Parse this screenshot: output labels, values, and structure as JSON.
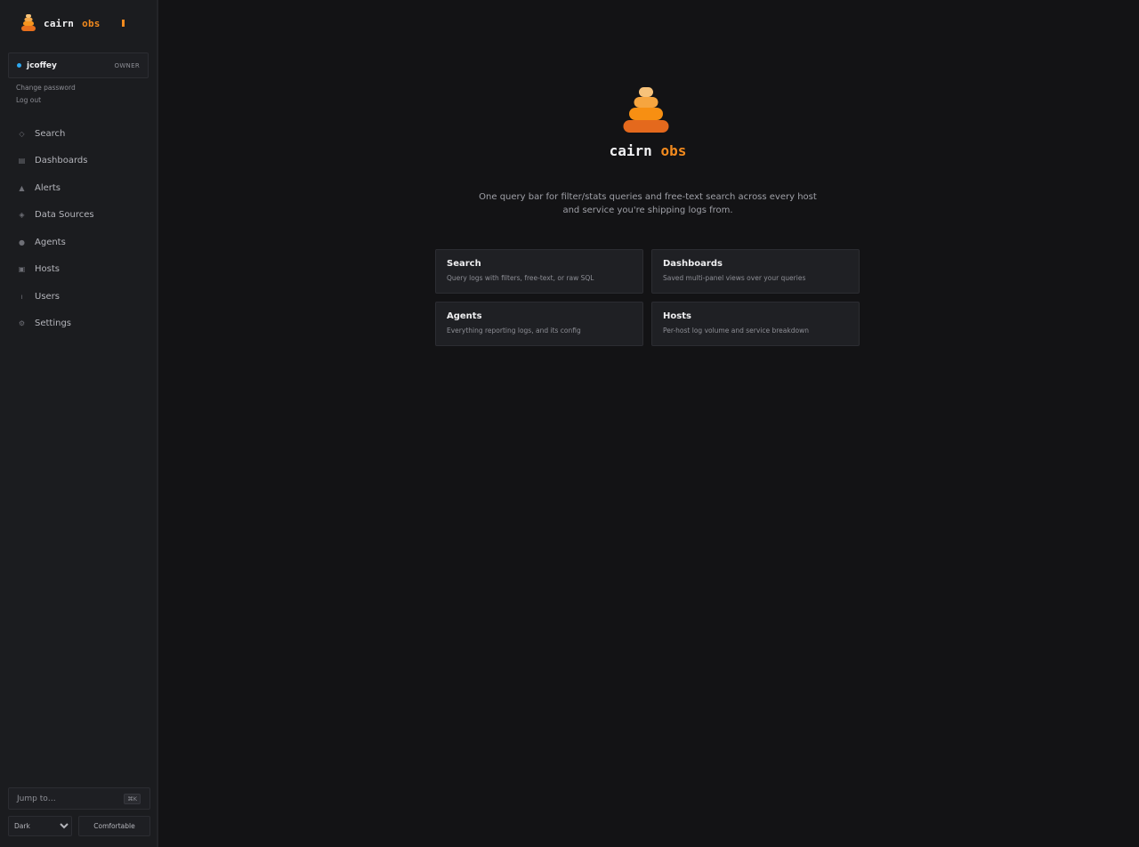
{
  "brand": {
    "name": "cairn",
    "accent": "obs",
    "accent_color": "#f28a1e"
  },
  "user": {
    "name": "jcoffey",
    "role": "OWNER",
    "status_color": "#2ea8ef"
  },
  "user_links": {
    "change_password": "Change password",
    "logout": "Log out"
  },
  "nav": {
    "items": [
      {
        "label": "Search",
        "icon": "diamond-outline-icon"
      },
      {
        "label": "Dashboards",
        "icon": "dashboard-grid-icon"
      },
      {
        "label": "Alerts",
        "icon": "triangle-alert-icon"
      },
      {
        "label": "Data Sources",
        "icon": "diamond-dot-icon"
      },
      {
        "label": "Agents",
        "icon": "dot-icon"
      },
      {
        "label": "Hosts",
        "icon": "server-square-icon"
      },
      {
        "label": "Users",
        "icon": "user-icon"
      },
      {
        "label": "Settings",
        "icon": "gear-icon"
      }
    ]
  },
  "jump": {
    "label": "Jump to…",
    "shortcut": "⌘K"
  },
  "footer": {
    "theme": "Dark",
    "density": "Comfortable"
  },
  "hero": {
    "title_main": "cairn",
    "title_accent": "obs",
    "description": "One query bar for filter/stats queries and free-text search across every host and service you're shipping logs from."
  },
  "cards": [
    {
      "title": "Search",
      "desc": "Query logs with filters, free-text, or raw SQL"
    },
    {
      "title": "Dashboards",
      "desc": "Saved multi-panel views over your queries"
    },
    {
      "title": "Agents",
      "desc": "Everything reporting logs, and its config"
    },
    {
      "title": "Hosts",
      "desc": "Per-host log volume and service breakdown"
    }
  ]
}
